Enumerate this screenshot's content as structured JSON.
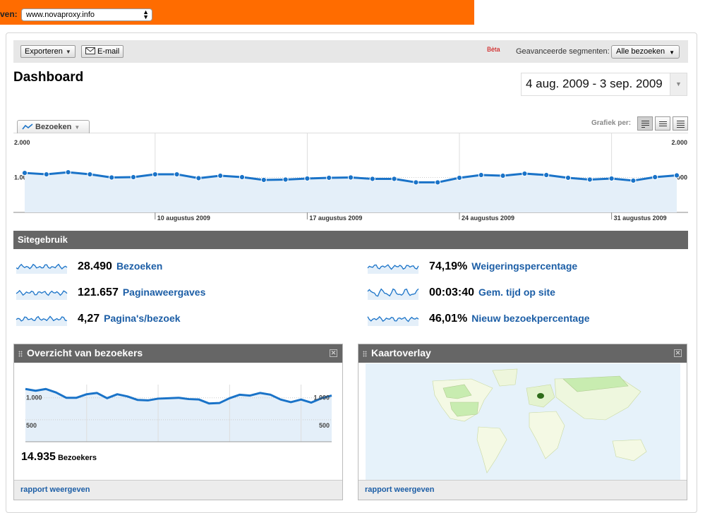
{
  "topbar": {
    "label": "ven:",
    "profile_value": "www.novaproxy.info"
  },
  "toolbar": {
    "export_label": "Exporteren",
    "email_label": "E-mail",
    "beta_label": "Bèta",
    "segments_label": "Geavanceerde segmenten:",
    "segments_value": "Alle bezoeken"
  },
  "header": {
    "title": "Dashboard",
    "date_range": "4 aug. 2009 - 3 sep. 2009"
  },
  "graph": {
    "metric_tab": "Bezoeken",
    "graph_by_label": "Grafiek per:"
  },
  "colors": {
    "accent_orange": "#ff6c00",
    "line_blue": "#1a73c8",
    "fill_blue": "#e4eff9",
    "link_blue": "#1c5ea6",
    "header_gray": "#666666"
  },
  "chart_data": [
    {
      "type": "area",
      "ylim": [
        0,
        2000
      ],
      "y_ticks": [
        "2.000",
        "1.000"
      ],
      "x_tick_labels": [
        "10 augustus 2009",
        "17 augustus 2009",
        "24 augustus 2009",
        "31 augustus 2009"
      ],
      "x": [
        "2009-08-04",
        "2009-08-05",
        "2009-08-06",
        "2009-08-07",
        "2009-08-08",
        "2009-08-09",
        "2009-08-10",
        "2009-08-11",
        "2009-08-12",
        "2009-08-13",
        "2009-08-14",
        "2009-08-15",
        "2009-08-16",
        "2009-08-17",
        "2009-08-18",
        "2009-08-19",
        "2009-08-20",
        "2009-08-21",
        "2009-08-22",
        "2009-08-23",
        "2009-08-24",
        "2009-08-25",
        "2009-08-26",
        "2009-08-27",
        "2009-08-28",
        "2009-08-29",
        "2009-08-30",
        "2009-08-31",
        "2009-09-01",
        "2009-09-02",
        "2009-09-03"
      ],
      "series": [
        {
          "values": [
            1130,
            1090,
            1150,
            1090,
            1000,
            1010,
            1090,
            1090,
            980,
            1050,
            1010,
            930,
            940,
            970,
            990,
            1000,
            960,
            960,
            860,
            860,
            990,
            1070,
            1050,
            1110,
            1070,
            990,
            940,
            970,
            910,
            1010,
            1060
          ]
        }
      ]
    },
    {
      "type": "line",
      "ylim": [
        0,
        1300
      ],
      "y_ticks": [
        "1.000",
        "500"
      ],
      "series": [
        {
          "values": [
            1200,
            1160,
            1200,
            1120,
            1000,
            1000,
            1080,
            1110,
            990,
            1080,
            1030,
            950,
            940,
            980,
            990,
            1000,
            970,
            960,
            870,
            880,
            990,
            1070,
            1050,
            1110,
            1070,
            960,
            900,
            960,
            890,
            990,
            1050
          ]
        }
      ]
    }
  ],
  "site_usage": {
    "title": "Sitegebruik",
    "metrics": [
      {
        "value": "28.490",
        "label": "Bezoeken"
      },
      {
        "value": "121.657",
        "label": "Paginaweergaves"
      },
      {
        "value": "4,27",
        "label": "Pagina's/bezoek"
      },
      {
        "value": "74,19%",
        "label": "Weigeringspercentage"
      },
      {
        "value": "00:03:40",
        "label": "Gem. tijd op site"
      },
      {
        "value": "46,01%",
        "label": "Nieuw bezoekpercentage"
      }
    ]
  },
  "visitors_widget": {
    "title": "Overzicht van bezoekers",
    "total_value": "14.935",
    "total_unit": "Bezoekers",
    "link": "rapport weergeven"
  },
  "map_widget": {
    "title": "Kaartoverlay",
    "link": "rapport weergeven"
  }
}
